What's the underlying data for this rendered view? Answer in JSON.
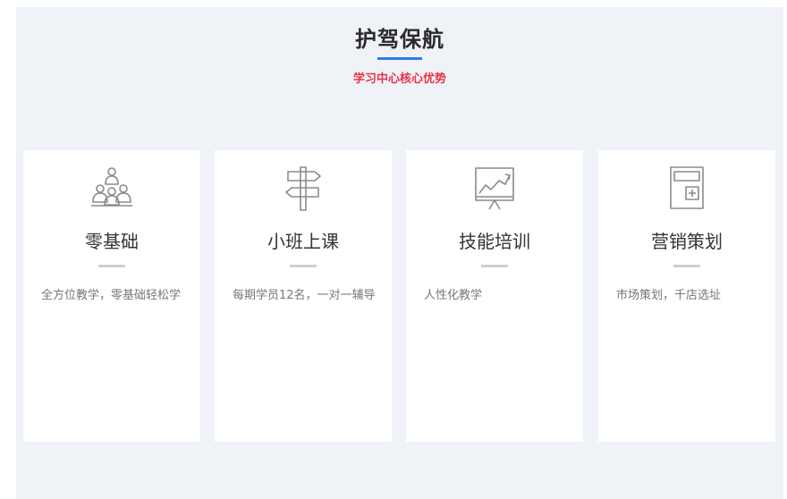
{
  "section": {
    "title": "护驾保航",
    "subtitle": "学习中心核心优势"
  },
  "colors": {
    "background": "#eff2f7",
    "accent_blue": "#2a7de1",
    "accent_red": "#e8334a",
    "icon_gray": "#8a8a8a"
  },
  "cards": [
    {
      "icon": "people-group-icon",
      "title": "零基础",
      "desc": "全方位教学，零基础轻松学"
    },
    {
      "icon": "signpost-icon",
      "title": "小班上课",
      "desc": "每期学员12名，一对一辅导"
    },
    {
      "icon": "presentation-chart-icon",
      "title": "技能培训",
      "desc": "人性化教学"
    },
    {
      "icon": "calculator-icon",
      "title": "营销策划",
      "desc": "市场策划，千店选址"
    }
  ]
}
